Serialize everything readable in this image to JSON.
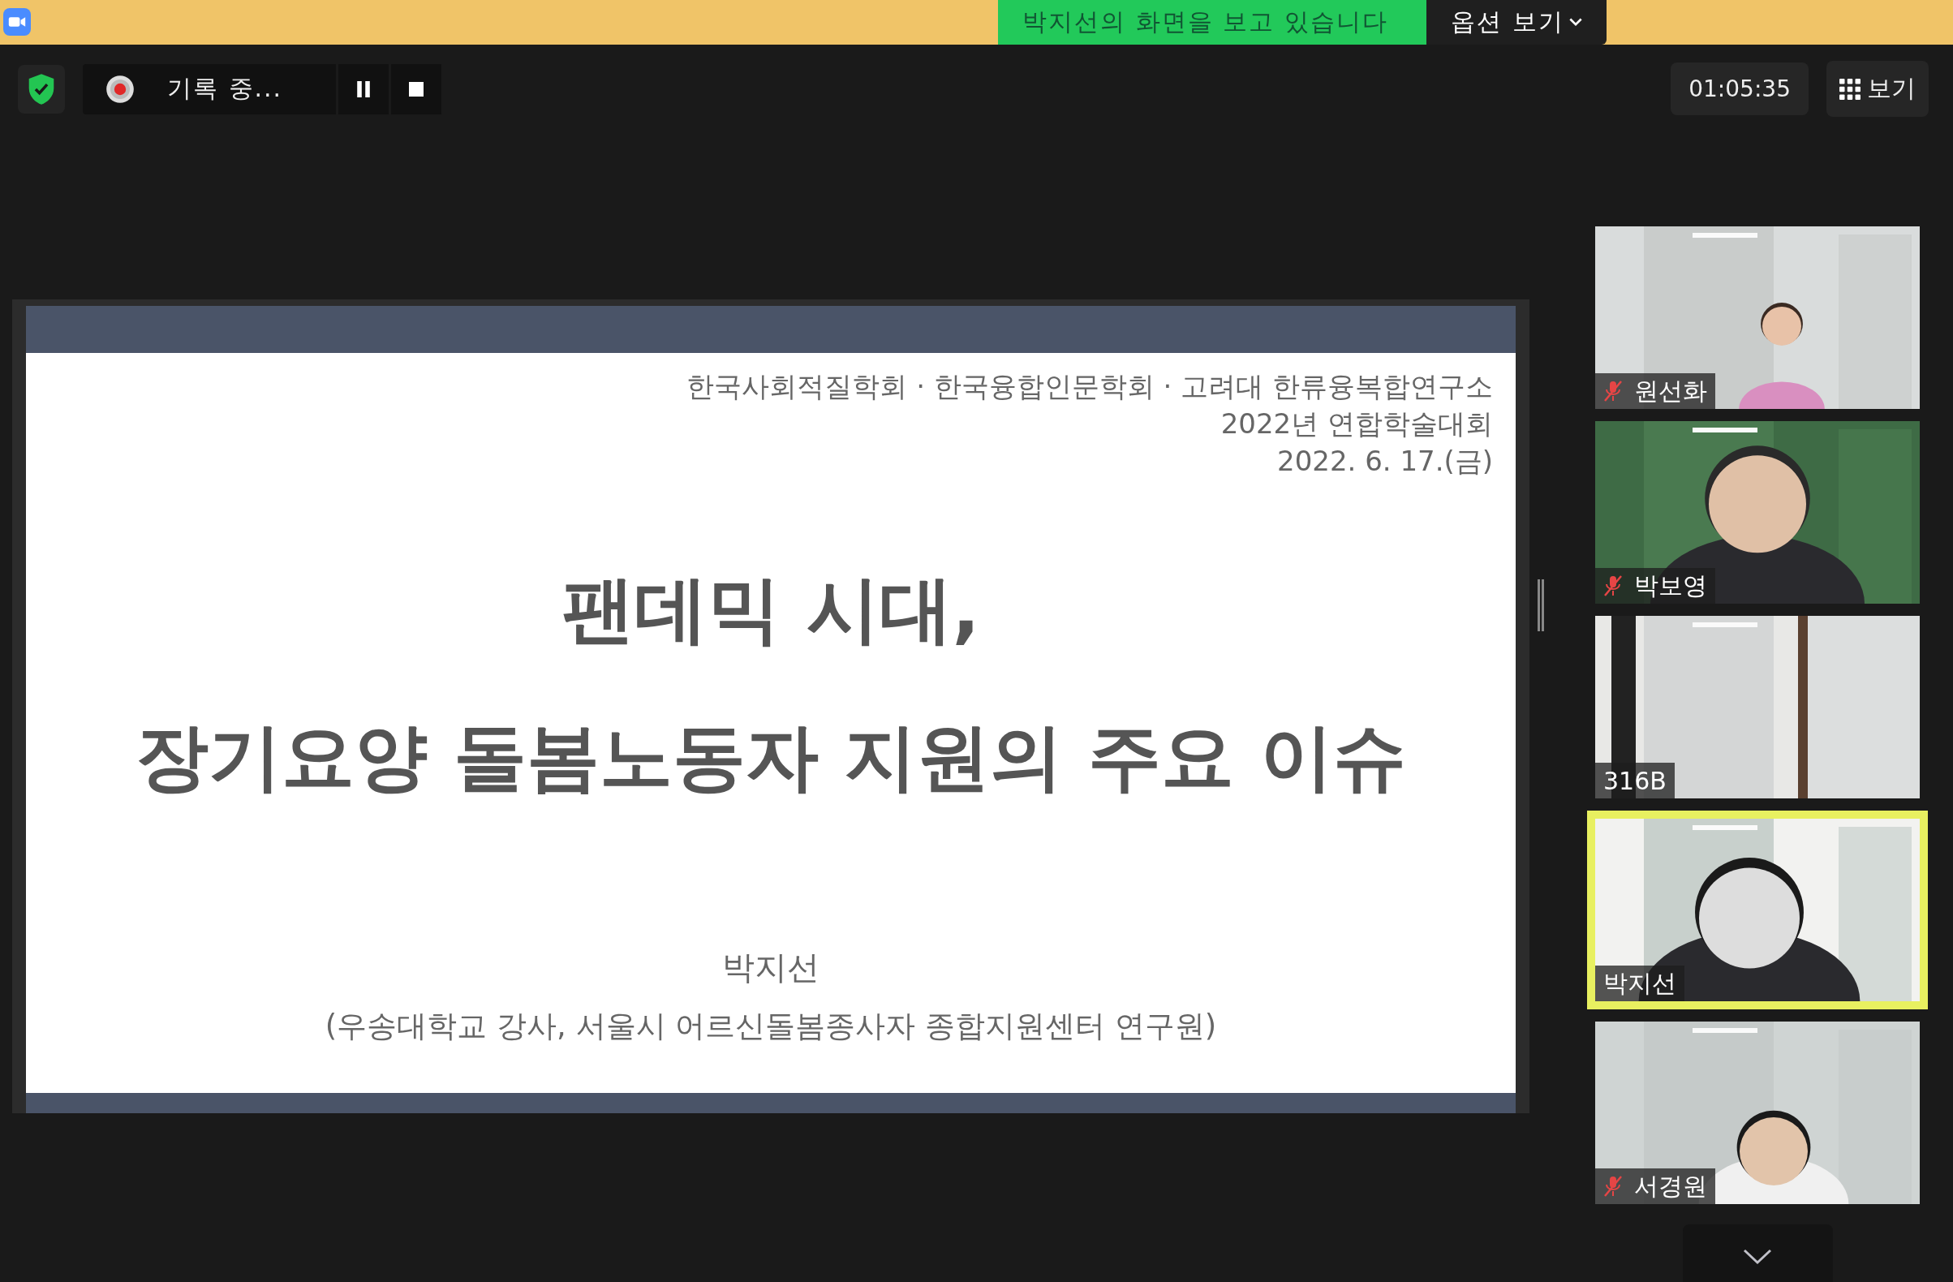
{
  "top_bar": {
    "banner": "박지선의 화면을 보고 있습니다",
    "options_button": "옵션 보기"
  },
  "recording": {
    "label": "기록 중..."
  },
  "timer": "01:05:35",
  "view_button": "보기",
  "slide": {
    "header_lines": [
      "한국사회적질학회 · 한국융합인문학회 · 고려대 한류융복합연구소",
      "2022년 연합학술대회",
      "2022. 6. 17.(금)"
    ],
    "title_lines": [
      "팬데믹 시대,",
      "장기요양 돌봄노동자 지원의 주요 이슈"
    ],
    "presenter": "박지선",
    "affiliation": "(우송대학교 강사, 서울시 어르신돌봄종사자 종합지원센터 연구원)"
  },
  "participants": [
    {
      "name": "원선화",
      "muted": true,
      "speaking": false
    },
    {
      "name": "박보영",
      "muted": true,
      "speaking": false
    },
    {
      "name": "316B",
      "muted": false,
      "speaking": false
    },
    {
      "name": "박지선",
      "muted": false,
      "speaking": true
    },
    {
      "name": "서경원",
      "muted": true,
      "speaking": false
    }
  ]
}
